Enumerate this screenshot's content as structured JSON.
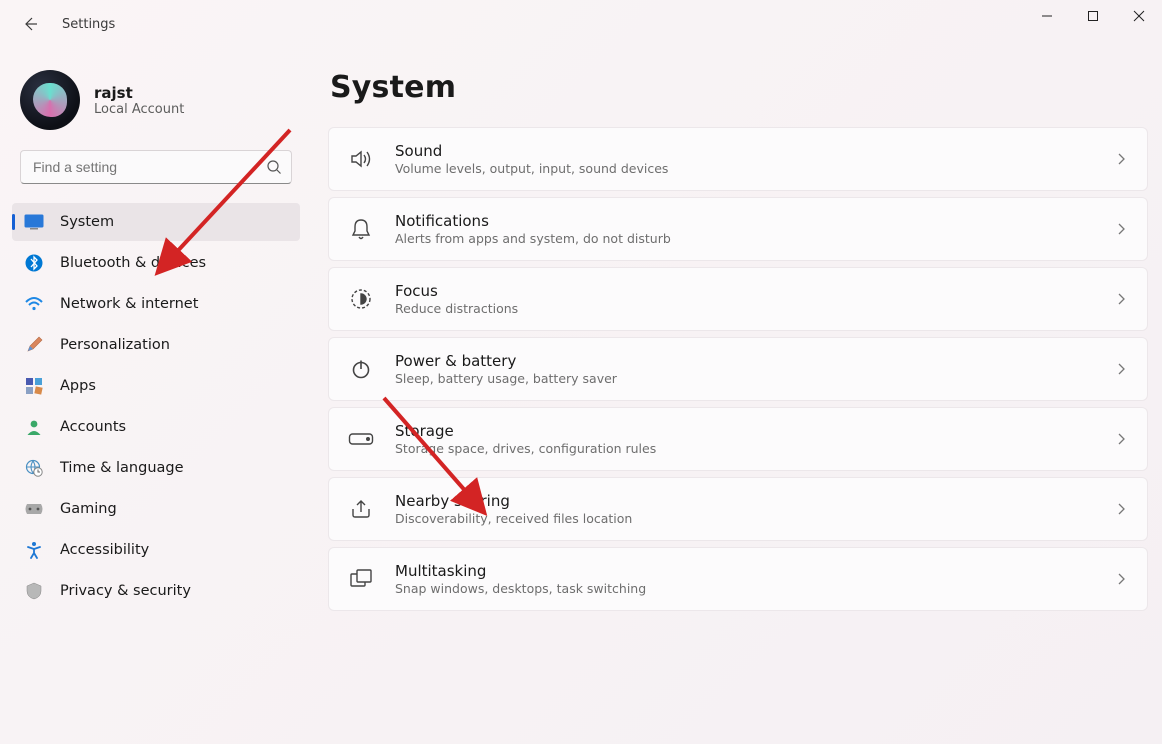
{
  "window": {
    "app_title": "Settings"
  },
  "user": {
    "name": "rajst",
    "subtitle": "Local Account"
  },
  "search": {
    "placeholder": "Find a setting"
  },
  "sidebar": {
    "items": [
      {
        "label": "System"
      },
      {
        "label": "Bluetooth & devices"
      },
      {
        "label": "Network & internet"
      },
      {
        "label": "Personalization"
      },
      {
        "label": "Apps"
      },
      {
        "label": "Accounts"
      },
      {
        "label": "Time & language"
      },
      {
        "label": "Gaming"
      },
      {
        "label": "Accessibility"
      },
      {
        "label": "Privacy & security"
      }
    ]
  },
  "page": {
    "title": "System"
  },
  "cards": [
    {
      "title": "Sound",
      "subtitle": "Volume levels, output, input, sound devices"
    },
    {
      "title": "Notifications",
      "subtitle": "Alerts from apps and system, do not disturb"
    },
    {
      "title": "Focus",
      "subtitle": "Reduce distractions"
    },
    {
      "title": "Power & battery",
      "subtitle": "Sleep, battery usage, battery saver"
    },
    {
      "title": "Storage",
      "subtitle": "Storage space, drives, configuration rules"
    },
    {
      "title": "Nearby sharing",
      "subtitle": "Discoverability, received files location"
    },
    {
      "title": "Multitasking",
      "subtitle": "Snap windows, desktops, task switching"
    }
  ],
  "annotations": {
    "arrow1_target": "sidebar-item-system",
    "arrow2_target": "card-storage"
  },
  "colors": {
    "accent": "#1560d4",
    "arrow": "#d32424"
  }
}
